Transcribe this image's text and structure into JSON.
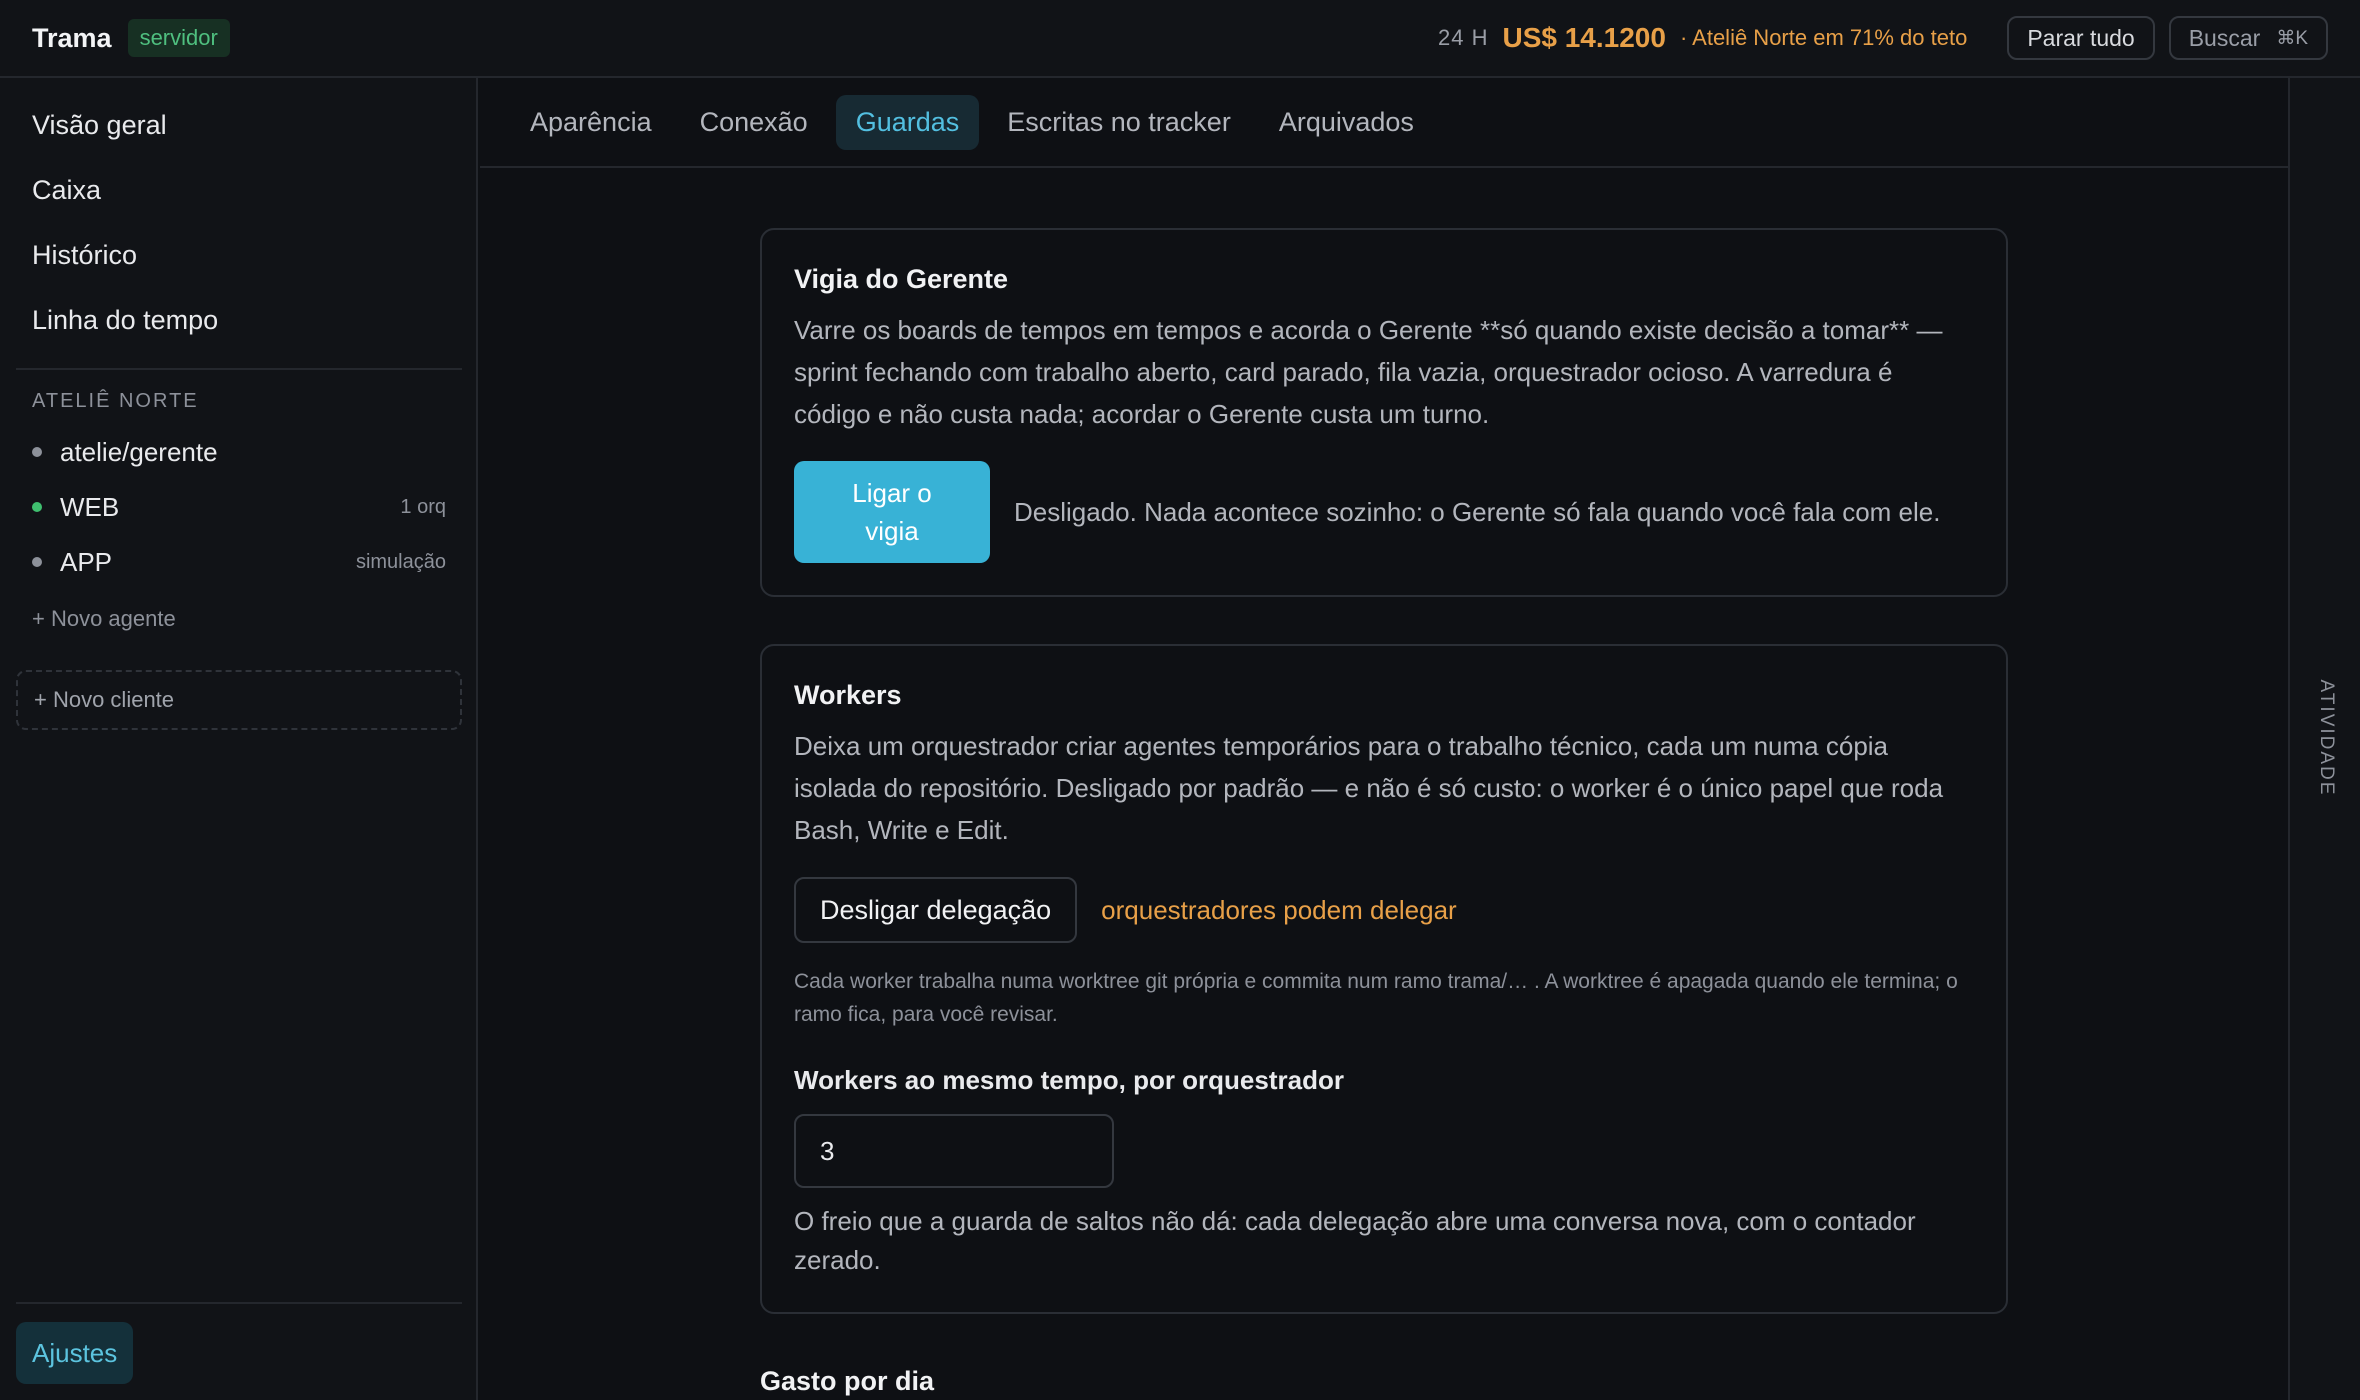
{
  "header": {
    "app_name": "Trama",
    "mode_badge": "servidor",
    "cost_period": "24 H",
    "cost_value": "US$ 14.1200",
    "cost_note": "· Ateliê Norte em 71% do teto",
    "stop_all_label": "Parar tudo",
    "search_label": "Buscar",
    "search_shortcut": "⌘K"
  },
  "sidebar": {
    "nav": [
      {
        "label": "Visão geral"
      },
      {
        "label": "Caixa"
      },
      {
        "label": "Histórico"
      },
      {
        "label": "Linha do tempo"
      }
    ],
    "client_section": "ATELIÊ NORTE",
    "agents": [
      {
        "name": "atelie/gerente",
        "tag": "",
        "status": "idle"
      },
      {
        "name": "WEB",
        "tag": "1 orq",
        "status": "active"
      },
      {
        "name": "APP",
        "tag": "simulação",
        "status": "idle"
      }
    ],
    "new_agent_label": "+ Novo agente",
    "new_client_label": "+ Novo cliente",
    "settings_label": "Ajustes"
  },
  "tabs": [
    {
      "label": "Aparência",
      "active": false
    },
    {
      "label": "Conexão",
      "active": false
    },
    {
      "label": "Guardas",
      "active": true
    },
    {
      "label": "Escritas no tracker",
      "active": false
    },
    {
      "label": "Arquivados",
      "active": false
    }
  ],
  "right_rail": {
    "label": "ATIVIDADE"
  },
  "watcher": {
    "title": "Vigia do Gerente",
    "description": "Varre os boards de tempos em tempos e acorda o Gerente **só quando existe decisão a tomar** — sprint fechando com trabalho aberto, card parado, fila vazia, orquestrador ocioso. A varredura é código e não custa nada; acordar o Gerente custa um turno.",
    "button_label": "Ligar o vigia",
    "status_note": "Desligado. Nada acontece sozinho: o Gerente só fala quando você fala com ele."
  },
  "workers": {
    "title": "Workers",
    "description": "Deixa um orquestrador criar agentes temporários para o trabalho técnico, cada um numa cópia isolada do repositório. Desligado por padrão — e não é só custo: o worker é o único papel que roda Bash, Write e Edit.",
    "toggle_label": "Desligar delegação",
    "toggle_status": "orquestradores podem delegar",
    "worktree_note": "Cada worker trabalha numa worktree git própria e commita num ramo trama/… . A worktree é apagada quando ele termina; o ramo fica, para você revisar.",
    "concurrency_label": "Workers ao mesmo tempo, por orquestrador",
    "concurrency_value": "3",
    "concurrency_note": "O freio que a guarda de saltos não dá: cada delegação abre uma conversa nova, com o contador zerado."
  },
  "next_section": {
    "title": "Gasto por dia"
  },
  "colors": {
    "accent": "#38b2d6",
    "warning": "#e8a048",
    "success": "#3fbf6f"
  }
}
